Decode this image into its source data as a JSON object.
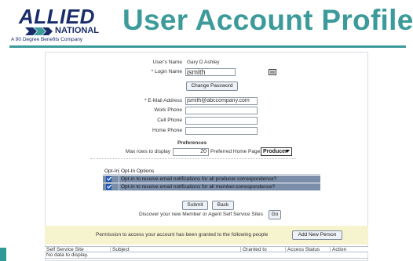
{
  "brand": {
    "logo_text": "ALLIED",
    "logo_subtext": "NATIONAL",
    "logo_tagline": "A 90 Degree Benefits Company",
    "accent_color": "#3c9b9a",
    "navy_color": "#1a2d6b"
  },
  "page": {
    "title": "User Account Profile"
  },
  "profile": {
    "users_name_label": "User's Name",
    "users_name_value": "Gary D Ashley",
    "login_label": "* Login Name",
    "login_value": "jsmith",
    "login_icon": "id-card-icon",
    "change_password_label": "Change Password",
    "email_label": "* E-Mail Address",
    "email_value": "jsmith@abccompany.com",
    "work_phone_label": "Work Phone",
    "work_phone_value": "",
    "cell_phone_label": "Cell Phone",
    "cell_phone_value": "",
    "home_phone_label": "Home Phone",
    "home_phone_value": ""
  },
  "preferences": {
    "heading": "Preferences",
    "max_rows_label": "Max rows to display",
    "max_rows_value": "20",
    "home_page_label": "Preferred Home Page",
    "home_page_value": "Producer"
  },
  "optin": {
    "col_optin": "Opt-In",
    "col_options": "Opt-In Options",
    "rows": [
      {
        "checked": true,
        "label": "Opt-in to receive email notifications for all producer correspondence?"
      },
      {
        "checked": true,
        "label": "Opt-in to receive email notifications for all member.correspondence?"
      }
    ]
  },
  "actions": {
    "submit_label": "Submit",
    "back_label": "Back",
    "discover_text": "Discover your new Member or Agent Self Service Sites",
    "go_label": "Go"
  },
  "permissions": {
    "text": "Permission to access your account has been granted to the following people",
    "add_label": "Add New Person",
    "columns": [
      "Self Service Site",
      "Subject",
      "Granted to",
      "Access Status",
      "Action"
    ],
    "empty_text": "No data to display."
  }
}
